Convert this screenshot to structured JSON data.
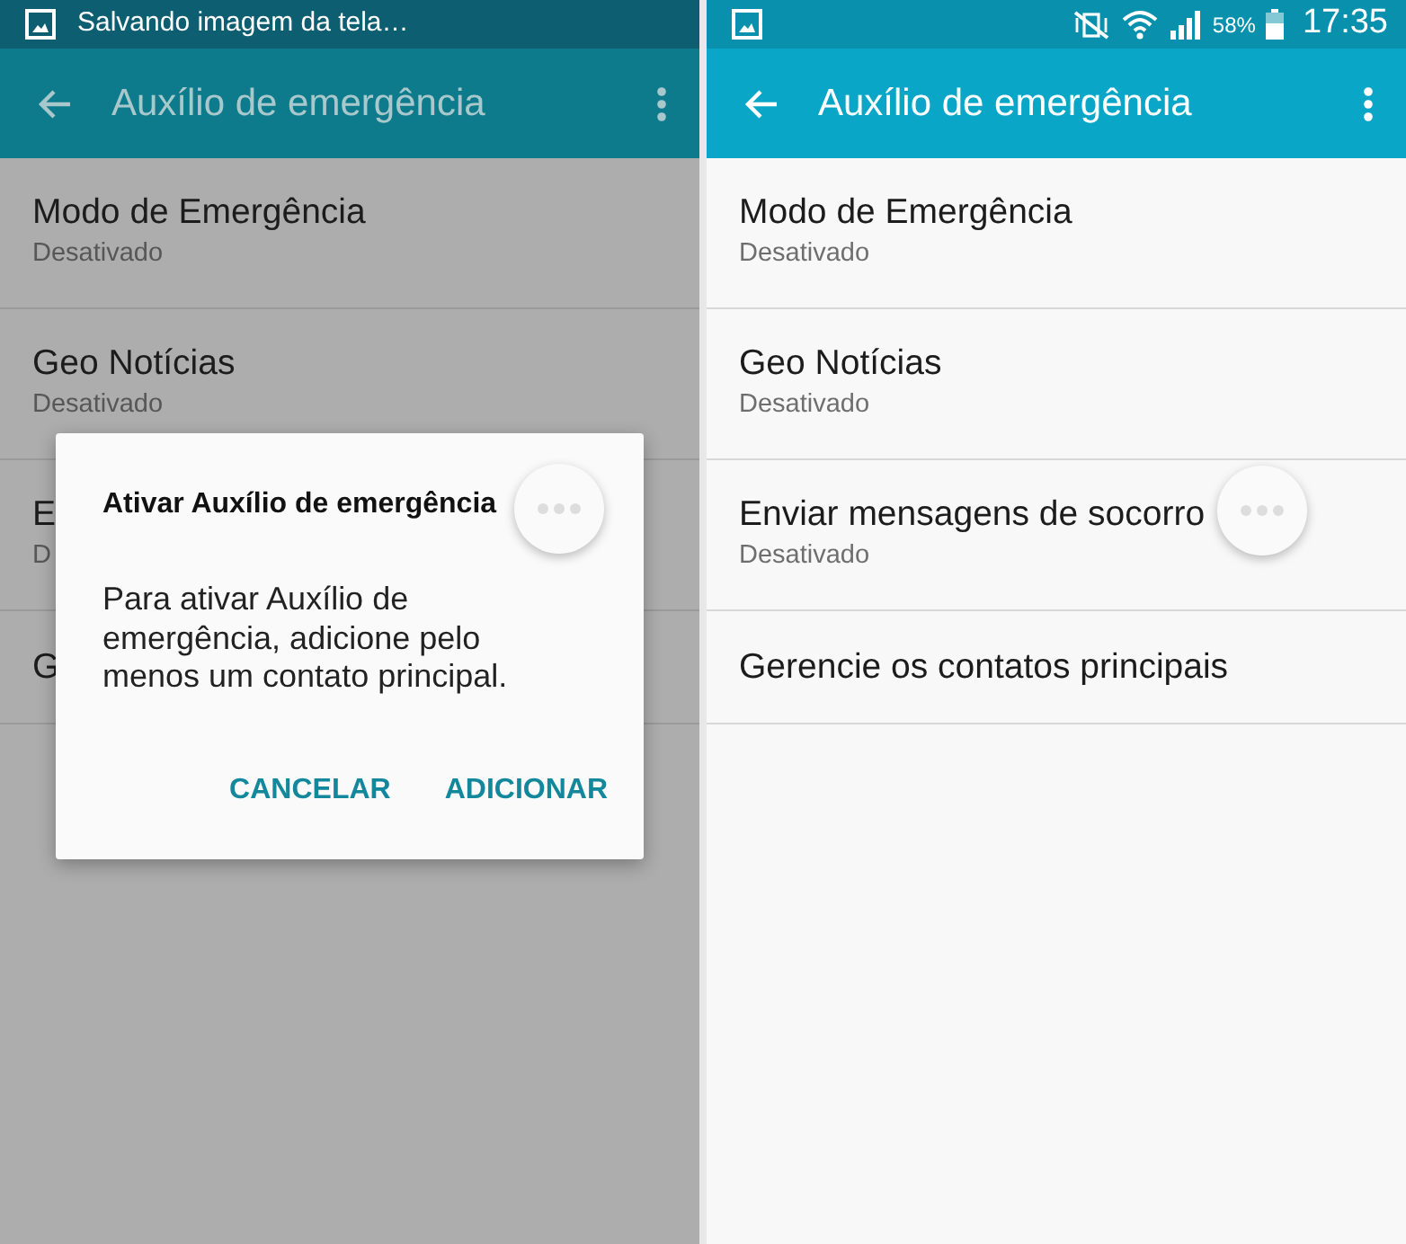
{
  "screens": [
    {
      "dimmed": true,
      "status_bar": {
        "notification": "Salvando imagem da tela…"
      },
      "app_bar": {
        "title": "Auxílio de emergência"
      },
      "items": [
        {
          "title": "Modo de Emergência",
          "subtitle": "Desativado"
        },
        {
          "title": "Geo Notícias",
          "subtitle": "Desativado"
        },
        {
          "title": "E",
          "subtitle": "D"
        },
        {
          "title": "G"
        }
      ],
      "dialog": {
        "title": "Ativar Auxílio de emergência",
        "message": "Para ativar Auxílio de emergência, adicione pelo menos um contato principal.",
        "buttons": [
          "CANCELAR",
          "ADICIONAR"
        ]
      }
    },
    {
      "dimmed": false,
      "status_bar": {
        "battery": "58%",
        "time": "17:35"
      },
      "app_bar": {
        "title": "Auxílio de emergência"
      },
      "items": [
        {
          "title": "Modo de Emergência",
          "subtitle": "Desativado"
        },
        {
          "title": "Geo Notícias",
          "subtitle": "Desativado"
        },
        {
          "title": "Enviar mensagens de socorro",
          "subtitle": "Desativado"
        },
        {
          "title": "Gerencie os contatos principais"
        }
      ]
    }
  ]
}
